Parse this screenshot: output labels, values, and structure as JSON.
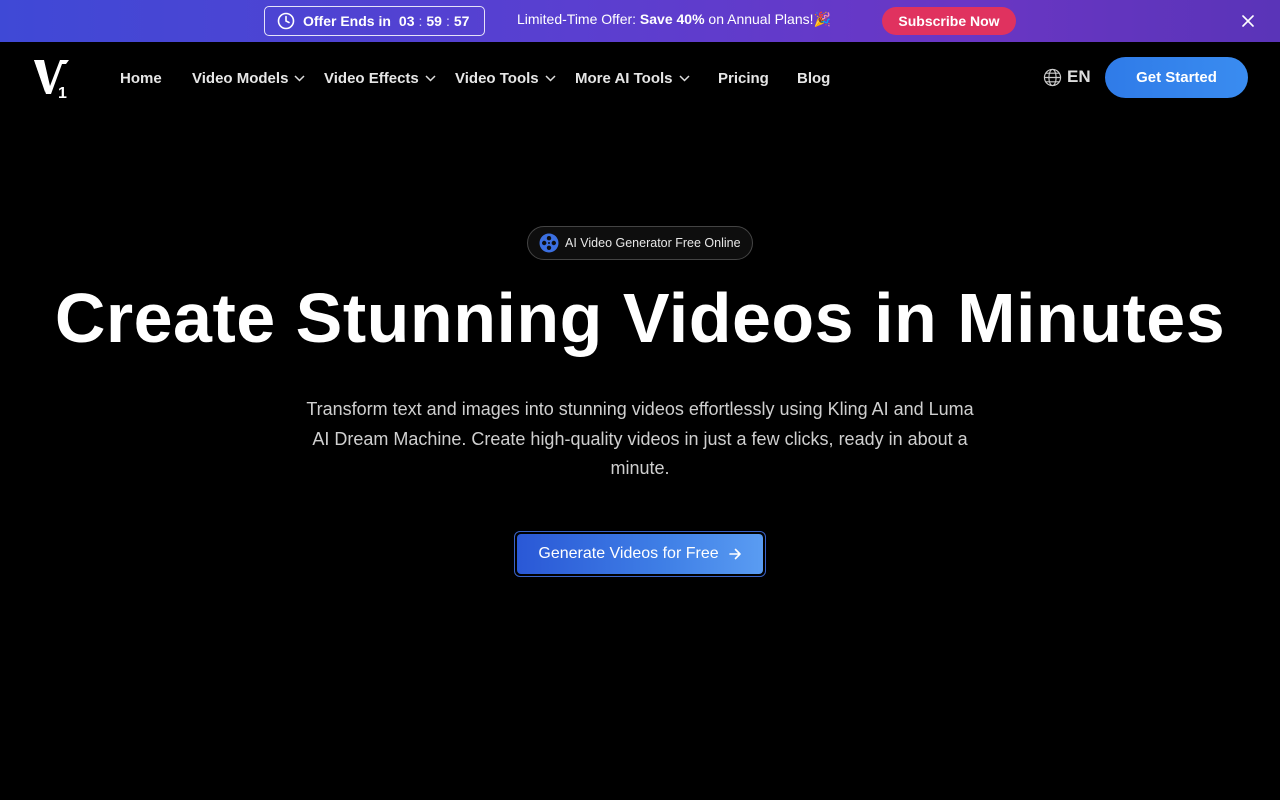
{
  "promo": {
    "timer_label": "Offer Ends in",
    "hours": "03",
    "minutes": "59",
    "seconds": "57",
    "offer_prefix": "Limited-Time Offer: ",
    "offer_bold": "Save 40%",
    "offer_suffix": " on Annual Plans!🎉",
    "subscribe_label": "Subscribe Now",
    "colors": {
      "bar_start": "#3f49d6",
      "bar_end": "#5a34b8",
      "subscribe": "#e0325f"
    }
  },
  "nav": {
    "items": [
      {
        "label": "Home",
        "has_dropdown": false
      },
      {
        "label": "Video Models",
        "has_dropdown": true
      },
      {
        "label": "Video Effects",
        "has_dropdown": true
      },
      {
        "label": "Video Tools",
        "has_dropdown": true
      },
      {
        "label": "More AI Tools",
        "has_dropdown": true
      },
      {
        "label": "Pricing",
        "has_dropdown": false
      },
      {
        "label": "Blog",
        "has_dropdown": false
      }
    ],
    "language": "EN",
    "get_started_label": "Get Started"
  },
  "hero": {
    "badge_label": "AI Video Generator Free Online",
    "title": "Create Stunning Videos in Minutes",
    "subtitle": "Transform text and images into stunning videos effortlessly using Kling AI and Luma AI Dream Machine. Create high-quality videos in just a few clicks, ready in about a minute.",
    "cta_label": "Generate Videos for Free",
    "accent": "#2f7be8"
  },
  "icons": {
    "timer": "clock-icon",
    "close": "close-icon",
    "language": "globe-icon",
    "badge": "film-reel-icon",
    "cta": "arrow-right-icon",
    "dropdown": "chevron-down-icon"
  }
}
